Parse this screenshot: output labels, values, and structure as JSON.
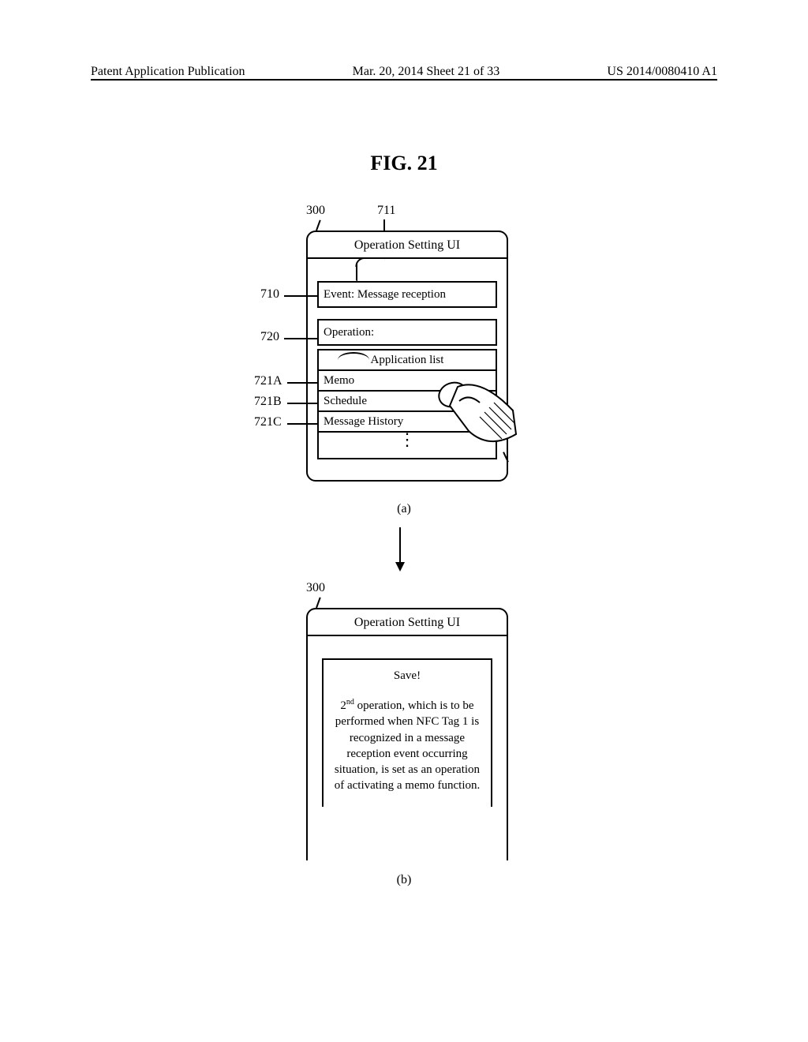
{
  "header": {
    "left": "Patent Application Publication",
    "mid": "Mar. 20, 2014  Sheet 21 of 33",
    "right": "US 2014/0080410 A1"
  },
  "figure_title": "FIG. 21",
  "refs": {
    "r300": "300",
    "r711": "711",
    "r710": "710",
    "r720": "720",
    "r721A": "721A",
    "r721B": "721B",
    "r721C": "721C"
  },
  "panel_a": {
    "title": "Operation Setting UI",
    "event_label": "Event: Message reception",
    "operation_label": "Operation:",
    "app_list_header": "Application list",
    "items": {
      "memo": "Memo",
      "schedule": "Schedule",
      "history": "Message History"
    },
    "sub": "(a)"
  },
  "panel_b": {
    "title": "Operation Setting UI",
    "save": "Save!",
    "body_prefix": "2",
    "body_ord": "nd",
    "body_rest": " operation, which is to be performed when NFC Tag 1 is recognized in a message reception event occurring situation, is set as an operation of activating a memo function.",
    "sub": "(b)"
  }
}
